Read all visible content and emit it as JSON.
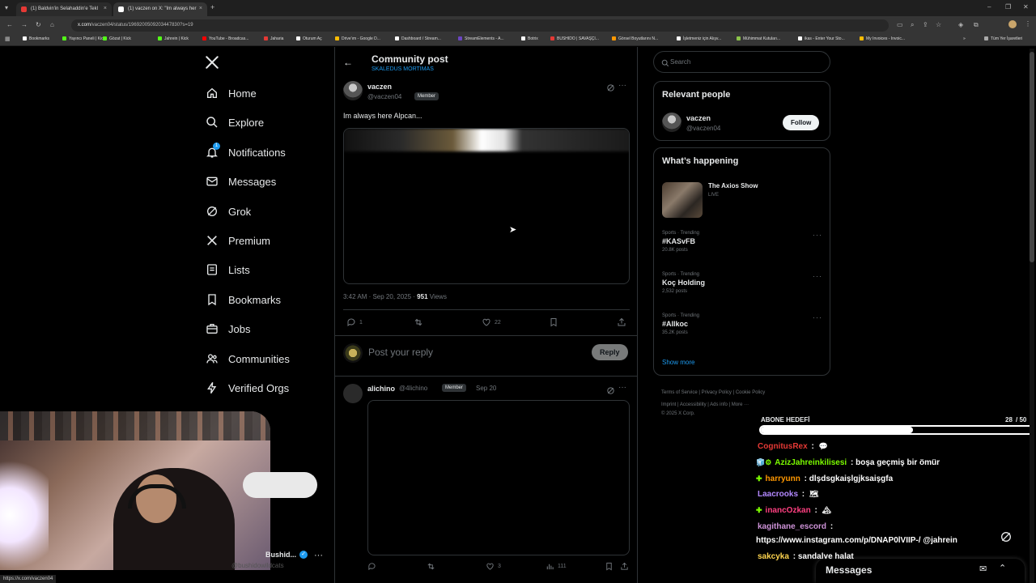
{
  "browser": {
    "tabs": [
      {
        "title": "(1) Baldvin'in Selahaddin'e Tekl",
        "fav_color": "#e53935"
      },
      {
        "title": "(1) vaczen on X: \"Im always her",
        "fav_color": "#ffffff"
      }
    ],
    "url_domain": "x.com",
    "url_path": "/vaczen04/status/1969200509203447830?s=19",
    "bookmarks": [
      {
        "label": "Bookmarks",
        "color": "#ffffff"
      },
      {
        "label": "Yayıncı Paneli | Kick",
        "color": "#53fc18"
      },
      {
        "label": "Gözat | Kick",
        "color": "#53fc18"
      },
      {
        "label": "Jahrein | Kick",
        "color": "#53fc18"
      },
      {
        "label": "YouTube - Broadcas...",
        "color": "#ff0000"
      },
      {
        "label": "Jaharia",
        "color": "#e53935"
      },
      {
        "label": "Oturum Aç",
        "color": "#ffffff"
      },
      {
        "label": "Drive'ım - Google D...",
        "color": "#fbbc04"
      },
      {
        "label": "Dashboard / Stream...",
        "color": "#ffffff"
      },
      {
        "label": "StreamElements - A...",
        "color": "#6b46c1"
      },
      {
        "label": "Botrix",
        "color": "#ffffff"
      },
      {
        "label": "BUSHIDO | SAVAŞÇI...",
        "color": "#e53935"
      },
      {
        "label": "Görsel Boyutlarını N...",
        "color": "#ff9800"
      },
      {
        "label": "İşletmeniz için Alışv...",
        "color": "#ffffff"
      },
      {
        "label": "Mühimmat Kutuları...",
        "color": "#8bc34a"
      },
      {
        "label": "ikas - Enter Your Sto...",
        "color": "#ffffff"
      },
      {
        "label": "My Invoices - Invoic...",
        "color": "#fbbc04"
      }
    ],
    "all_bookmarks": "Tüm Yer İşaretleri",
    "status_url": "https://x.com/vaczen04"
  },
  "nav": {
    "items": [
      {
        "label": "Home",
        "icon": "home-icon"
      },
      {
        "label": "Explore",
        "icon": "search-icon"
      },
      {
        "label": "Notifications",
        "icon": "bell-icon",
        "badge": "1"
      },
      {
        "label": "Messages",
        "icon": "envelope-icon"
      },
      {
        "label": "Grok",
        "icon": "grok-icon"
      },
      {
        "label": "Premium",
        "icon": "x-icon"
      },
      {
        "label": "Lists",
        "icon": "list-icon"
      },
      {
        "label": "Bookmarks",
        "icon": "bookmark-icon"
      },
      {
        "label": "Jobs",
        "icon": "briefcase-icon"
      },
      {
        "label": "Communities",
        "icon": "people-icon"
      },
      {
        "label": "Verified Orgs",
        "icon": "lightning-icon"
      }
    ],
    "account_name": "Bushid...",
    "account_handle": "@bushidowildcats"
  },
  "post_header": {
    "title": "Community post",
    "community": "SKALEDUS MORTIMAS"
  },
  "post": {
    "author": "vaczen",
    "handle": "@vaczen04",
    "badge": "Member",
    "text": "Im always here Alpcan...",
    "time": "3:42 AM · Sep 20, 2025 · ",
    "views": "951",
    "views_label": " Views",
    "replies": "1",
    "likes": "22"
  },
  "reply_box": {
    "placeholder": "Post your reply",
    "button": "Reply"
  },
  "reply": {
    "author": "alichino",
    "handle": "@4lichino",
    "badge": "Member",
    "date": "Sep 20",
    "likes": "3",
    "views": "111"
  },
  "sidebar": {
    "search_placeholder": "Search",
    "relevant_title": "Relevant people",
    "person_name": "vaczen",
    "person_handle": "@vaczen04",
    "follow_label": "Follow",
    "happening_title": "What’s happening",
    "live_title": "The Axios Show",
    "live_label": "LIVE",
    "trends": [
      {
        "meta": "Sports · Trending",
        "name": "#KASvFB",
        "count": "20.8K posts"
      },
      {
        "meta": "Sports · Trending",
        "name": "Koç Holding",
        "count": "2,532 posts"
      },
      {
        "meta": "Sports · Trending",
        "name": "#Allkoc",
        "count": "35.2K posts"
      }
    ],
    "show_more": "Show more",
    "footer": [
      "Terms of Service",
      "Privacy Policy",
      "Cookie Policy",
      "Imprint",
      "Accessibility",
      "Ads info",
      "More ···"
    ],
    "copyright": "© 2025 X Corp."
  },
  "overlay": {
    "goal_label": "ABONE HEDEFİ",
    "goal_current": "28",
    "goal_total": "/ 50",
    "goal_fraction": 0.56,
    "chat": [
      {
        "user": "CognitusRex",
        "color": "#e53935",
        "msg": " : ",
        "emote": "💬"
      },
      {
        "user": "AzizJahreinkilisesi",
        "color": "#7cfc00",
        "msg": " : boşa geçmiş bir ömür",
        "prefix": "🧊⚙"
      },
      {
        "user": "harryunn",
        "color": "#ff9800",
        "msg": " : dlşdsgkaişlgjksaişgfa",
        "prefix": "✚"
      },
      {
        "user": "Laacrooks",
        "color": "#b388ff",
        "msg": " : ",
        "emote": "🗺"
      },
      {
        "user": "inancOzkan",
        "color": "#ff4081",
        "msg": " : ",
        "emote": "🏔",
        "prefix": "✚"
      },
      {
        "user": "kagithane_escord",
        "color": "#ce93d8",
        "msg": " :"
      },
      {
        "user": "",
        "color": "#ffffff",
        "msg": "https://www.instagram.com/p/DNAP0lVIIP-/ @jahrein"
      },
      {
        "user": "sakcyka",
        "color": "#ffd54f",
        "msg": " : sandalye halat"
      }
    ],
    "messages_label": "Messages"
  }
}
